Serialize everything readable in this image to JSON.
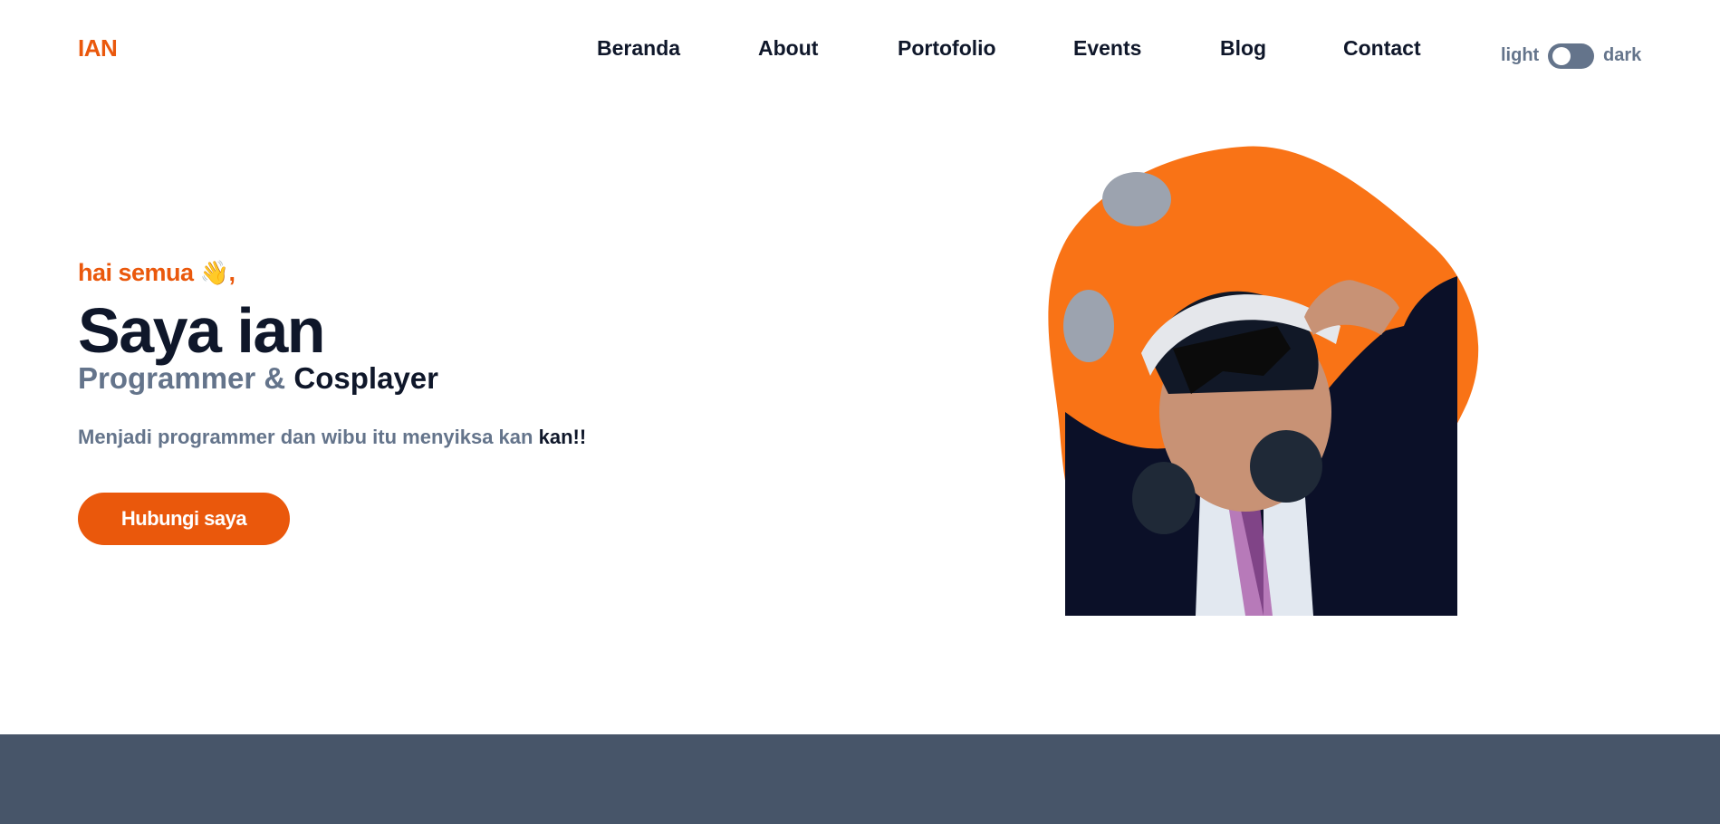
{
  "header": {
    "logo": "IAN",
    "nav": [
      {
        "label": "Beranda"
      },
      {
        "label": "About"
      },
      {
        "label": "Portofolio"
      },
      {
        "label": "Events"
      },
      {
        "label": "Blog"
      },
      {
        "label": "Contact"
      }
    ],
    "theme_toggle": {
      "left_label": "light",
      "right_label": "dark",
      "state": "light"
    }
  },
  "hero": {
    "greeting": "hai semua",
    "greeting_emoji": "👋",
    "greeting_suffix": ",",
    "title": "Saya ian",
    "role_part1": "Programmer &",
    "role_part2": "Cosplayer",
    "tagline_part1": "Menjadi programmer dan wibu itu menyiksa kan",
    "tagline_part2": "kan!!",
    "cta_label": "Hubungi saya"
  },
  "colors": {
    "accent": "#ea580c",
    "blob": "#f97316",
    "heading": "#0f172a",
    "muted": "#64748b",
    "footer_band": "#475569"
  },
  "icons": {
    "greeting": "waving-hand-icon"
  }
}
